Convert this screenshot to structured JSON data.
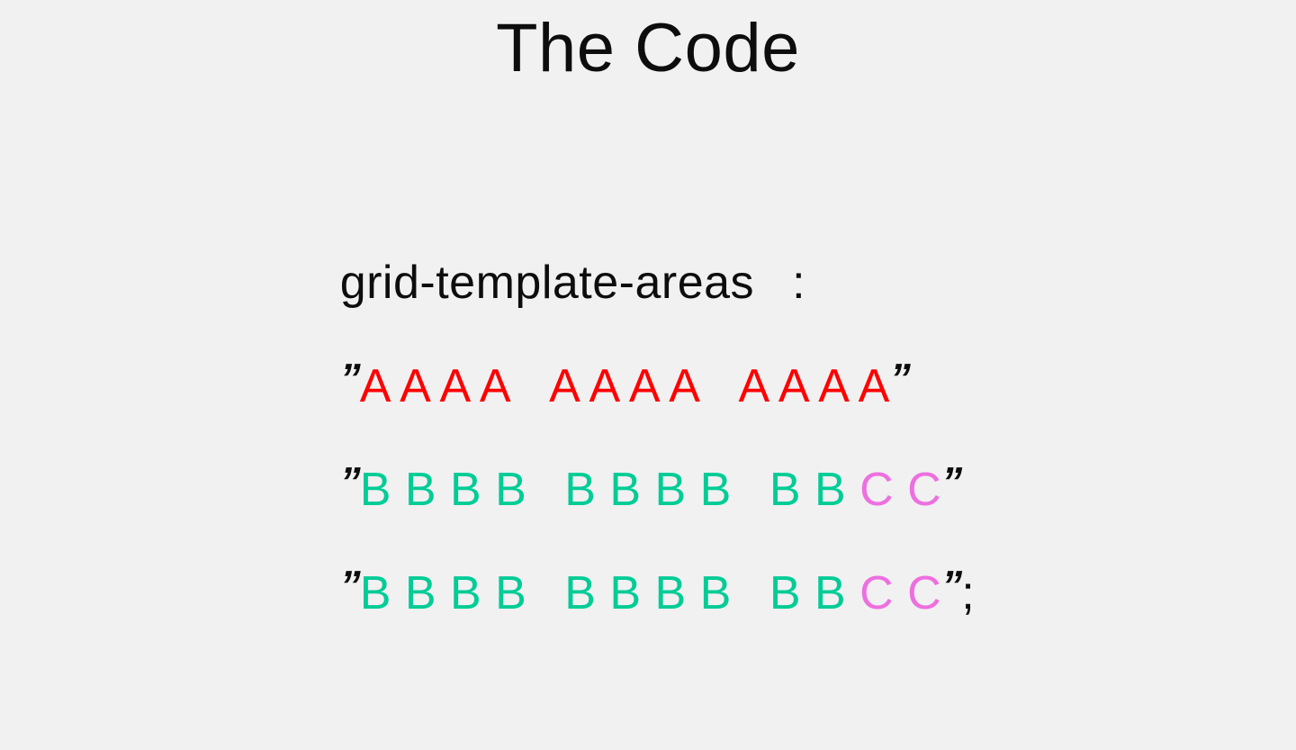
{
  "slide": {
    "background_color": "#f1f1f1",
    "title": "The Code"
  },
  "code": {
    "property_name": "grid-template-areas",
    "colon": ":",
    "open_quote": "”",
    "close_quote": "”",
    "terminator": ";",
    "colors": {
      "area_a": "#ff0000",
      "area_b": "#00cc96",
      "area_c": "#ee6fe0",
      "punctuation": "#0d0d0d"
    },
    "rows": [
      {
        "row_index": 1,
        "groups": [
          {
            "text": "A A A A",
            "area": "A"
          },
          {
            "text": "A A A A",
            "area": "A"
          },
          {
            "text": "A A A A",
            "area": "A"
          }
        ],
        "trailing": ""
      },
      {
        "row_index": 2,
        "groups": [
          {
            "text": "B B B B",
            "area": "B"
          },
          {
            "text": "B B B B",
            "area": "B"
          },
          {
            "text": "B B",
            "area": "B"
          },
          {
            "text": "C C",
            "area": "C"
          }
        ],
        "trailing": ""
      },
      {
        "row_index": 3,
        "groups": [
          {
            "text": "B B B B",
            "area": "B"
          },
          {
            "text": "B B B B",
            "area": "B"
          },
          {
            "text": "B B",
            "area": "B"
          },
          {
            "text": "C C",
            "area": "C"
          }
        ],
        "trailing": ";"
      }
    ]
  }
}
